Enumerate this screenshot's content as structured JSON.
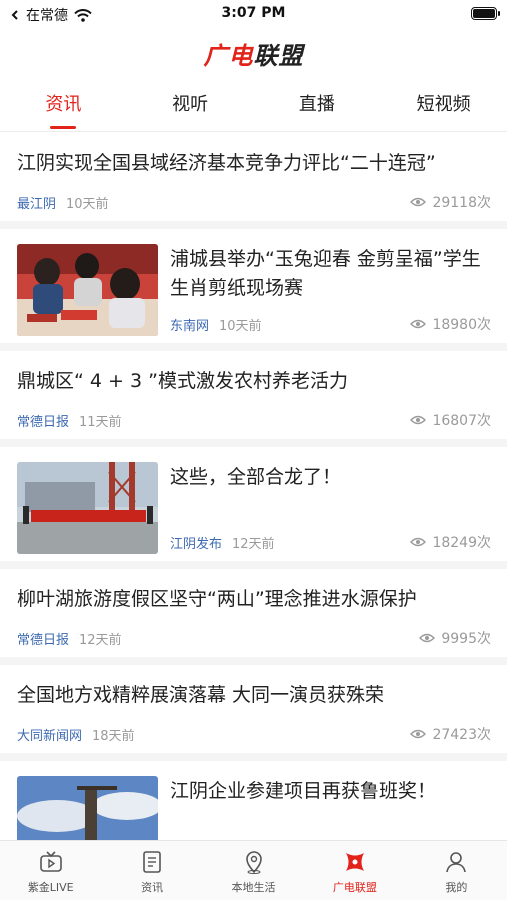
{
  "status_bar": {
    "carrier": "在常德",
    "time": "3:07 PM"
  },
  "header": {
    "logo_part1": "广电",
    "logo_part2": "联盟"
  },
  "tabs": [
    {
      "label": "资讯",
      "active": true
    },
    {
      "label": "视听",
      "active": false
    },
    {
      "label": "直播",
      "active": false
    },
    {
      "label": "短视频",
      "active": false
    }
  ],
  "feed": {
    "items": [
      {
        "title": "江阴实现全国县域经济基本竞争力评比“二十连冠”",
        "source": "最江阴",
        "time": "10天前",
        "views": "29118次"
      },
      {
        "title": "浦城县举办“玉兔迎春 金剪呈福”学生生肖剪纸现场赛",
        "source": "东南网",
        "time": "10天前",
        "views": "18980次",
        "image": "students-papercut-photo"
      },
      {
        "title": "鼎城区“ 4 + 3 ”模式激发农村养老活力",
        "source": "常德日报",
        "time": "11天前",
        "views": "16807次"
      },
      {
        "title": "这些，全部合龙了！",
        "source": "江阴发布",
        "time": "12天前",
        "views": "18249次",
        "image": "construction-banner-photo"
      },
      {
        "title": "柳叶湖旅游度假区坚守“两山”理念推进水源保护",
        "source": "常德日报",
        "time": "12天前",
        "views": "9995次"
      },
      {
        "title": "全国地方戏精粹展演落幕 大同一演员获殊荣",
        "source": "大同新闻网",
        "time": "18天前",
        "views": "27423次"
      },
      {
        "title": "江阴企业参建项目再获鲁班奖！",
        "image": "tower-crane-photo"
      }
    ]
  },
  "tab_bar": [
    {
      "label": "紫金LIVE",
      "icon": "tv-icon",
      "active": false
    },
    {
      "label": "资讯",
      "icon": "document-icon",
      "active": false
    },
    {
      "label": "本地生活",
      "icon": "location-pin-icon",
      "active": false
    },
    {
      "label": "广电联盟",
      "icon": "alliance-logo-icon",
      "active": true
    },
    {
      "label": "我的",
      "icon": "person-icon",
      "active": false
    }
  ],
  "colors": {
    "accent": "#e2231a",
    "source_link": "#3d6ab1",
    "muted": "#9a9a9a"
  }
}
